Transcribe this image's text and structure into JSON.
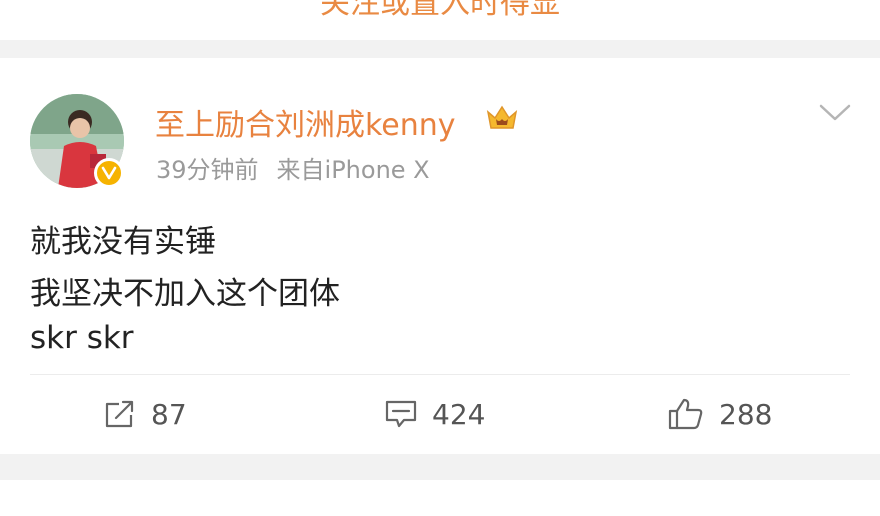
{
  "top_partial_text": "关注或置入时得显",
  "post": {
    "username": "至上励合刘洲成kenny",
    "time": "39分钟前",
    "source": "来自iPhone X",
    "lines": [
      "就我没有实锤",
      "我坚决不加入这个团体",
      "skr skr"
    ],
    "icons": {
      "avatar": "avatar-photo",
      "badge": "verified-badge-icon",
      "crown": "crown-icon",
      "menu": "chevron-down-icon"
    }
  },
  "actions": {
    "repost": {
      "icon": "share-icon",
      "count": "87"
    },
    "comment": {
      "icon": "comment-icon",
      "count": "424"
    },
    "like": {
      "icon": "thumbs-up-icon",
      "count": "288"
    }
  },
  "colors": {
    "username": "#e8823f",
    "badge": "#f6b300",
    "meta": "#9a9a9a"
  }
}
